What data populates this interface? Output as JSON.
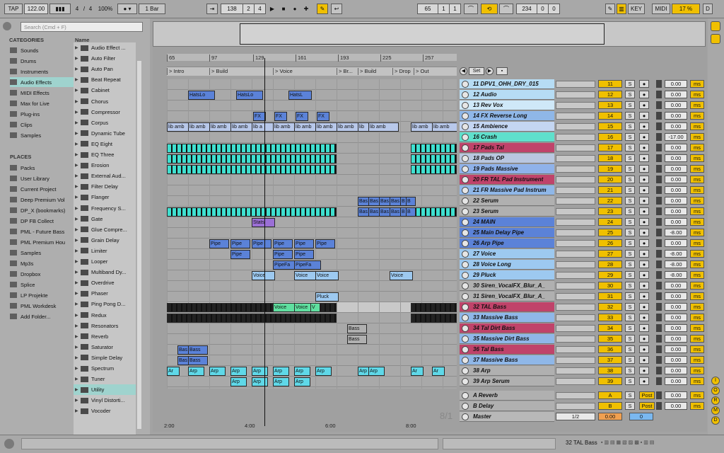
{
  "transport": {
    "tap": "TAP",
    "tempo": "122.00",
    "sig_num": "4",
    "sig_den": "4",
    "zoom": "100%",
    "quant": "1 Bar",
    "pos": [
      "138",
      "2",
      "4"
    ],
    "loop_start": [
      "65",
      "1",
      "1"
    ],
    "loop_len": [
      "234",
      "0",
      "0"
    ],
    "key": "KEY",
    "midi": "MIDI",
    "cpu": "17 %",
    "d": "D"
  },
  "browser": {
    "search_placeholder": "Search (Cmd + F)",
    "categories_header": "CATEGORIES",
    "categories": [
      "Sounds",
      "Drums",
      "Instruments",
      "Audio Effects",
      "MIDI Effects",
      "Max for Live",
      "Plug-ins",
      "Clips",
      "Samples"
    ],
    "places_header": "PLACES",
    "places": [
      "Packs",
      "User Library",
      "Current Project",
      "Deep Premium Vol",
      "DP_X (bookmarks)",
      "DP FB Collect",
      "PML - Future Bass",
      "PML Premium Hou",
      "Samples",
      "Mp3s",
      "Dropbox",
      "Splice",
      "LP Projekte",
      "PML Workdesk",
      "Add Folder..."
    ],
    "name_header": "Name",
    "items": [
      "Audio Effect ...",
      "Auto Filter",
      "Auto Pan",
      "Beat Repeat",
      "Cabinet",
      "Chorus",
      "Compressor",
      "Corpus",
      "Dynamic Tube",
      "EQ Eight",
      "EQ Three",
      "Erosion",
      "External Aud...",
      "Filter Delay",
      "Flanger",
      "Frequency S...",
      "Gate",
      "Glue Compre...",
      "Grain Delay",
      "Limiter",
      "Looper",
      "Multiband Dy...",
      "Overdrive",
      "Phaser",
      "Ping Pong D...",
      "Redux",
      "Resonators",
      "Reverb",
      "Saturator",
      "Simple Delay",
      "Spectrum",
      "Tuner",
      "Utility",
      "Vinyl Distorti...",
      "Vocoder"
    ]
  },
  "ruler": [
    "65",
    "97",
    "129",
    "161",
    "193",
    "225",
    "257"
  ],
  "locators": [
    "Intro",
    "Build",
    "Voice",
    "Br...",
    "Build",
    "Drop",
    "Out"
  ],
  "set_label": "Set",
  "times": [
    "2:00",
    "4:00",
    "6:00",
    "8:00"
  ],
  "bar_counter": "8/1",
  "tracks": [
    {
      "name": "11 DPV1_OHH_DRY_015",
      "num": "11",
      "vol": "0.00",
      "color": "#b6dcf4"
    },
    {
      "name": "12 Audio",
      "num": "12",
      "vol": "0.00",
      "color": "#b6dcf4"
    },
    {
      "name": "13 Rev Vox",
      "num": "13",
      "vol": "0.00",
      "color": "#cfe8f8"
    },
    {
      "name": "14 FX Reverse Long",
      "num": "14",
      "vol": "0.00",
      "color": "#8fb7e8"
    },
    {
      "name": "15 Ambience",
      "num": "15",
      "vol": "0.00",
      "color": "#c4d6f2"
    },
    {
      "name": "16 Crash",
      "num": "16",
      "vol": "-17.00",
      "color": "#5fe0cc"
    },
    {
      "name": "17 Pads Tal",
      "num": "17",
      "vol": "0.00",
      "color": "#c0436a"
    },
    {
      "name": "18 Pads OP",
      "num": "18",
      "vol": "0.00",
      "color": "#b9c7e0"
    },
    {
      "name": "19 Pads Massive",
      "num": "19",
      "vol": "0.00",
      "color": "#8fb2ea"
    },
    {
      "name": "20 FR TAL Pad Instrument",
      "num": "20",
      "vol": "0.00",
      "color": "#c0436a"
    },
    {
      "name": "21 FR Massive Pad Instrum",
      "num": "21",
      "vol": "0.00",
      "color": "#8fb7e8"
    },
    {
      "name": "22 Serum",
      "num": "22",
      "vol": "0.00",
      "color": "#b0b0b0"
    },
    {
      "name": "23 Serum",
      "num": "23",
      "vol": "0.00",
      "color": "#b0b0b0"
    },
    {
      "name": "24 MAIN",
      "num": "24",
      "vol": "0.00",
      "color": "#5b82d8"
    },
    {
      "name": "25 Main Delay Pipe",
      "num": "25",
      "vol": "-8.00",
      "color": "#5b82d8"
    },
    {
      "name": "26 Arp Pipe",
      "num": "26",
      "vol": "0.00",
      "color": "#5b82d8"
    },
    {
      "name": "27 Voice",
      "num": "27",
      "vol": "-8.00",
      "color": "#9dc9f0"
    },
    {
      "name": "28 Voice Long",
      "num": "28",
      "vol": "-8.00",
      "color": "#9dc9f0"
    },
    {
      "name": "29 Pluck",
      "num": "29",
      "vol": "-8.00",
      "color": "#9dc9f0"
    },
    {
      "name": "30 Siren_VocalFX_Blur_A_",
      "num": "30",
      "vol": "0.00",
      "color": "#b0b0b0"
    },
    {
      "name": "31 Siren_VocalFX_Blur_A_",
      "num": "31",
      "vol": "0.00",
      "color": "#b0b0b0"
    },
    {
      "name": "32 TAL Bass",
      "num": "32",
      "vol": "0.00",
      "color": "#c0436a"
    },
    {
      "name": "33 Massive Bass",
      "num": "33",
      "vol": "0.00",
      "color": "#8fb7e8"
    },
    {
      "name": "34 Tal Dirt Bass",
      "num": "34",
      "vol": "0.00",
      "color": "#c0436a"
    },
    {
      "name": "35 Massive Dirt Bass",
      "num": "35",
      "vol": "0.00",
      "color": "#8fb7e8"
    },
    {
      "name": "36 Tal Bass",
      "num": "36",
      "vol": "0.00",
      "color": "#c0436a"
    },
    {
      "name": "37 Massive Bass",
      "num": "37",
      "vol": "0.00",
      "color": "#8fb7e8"
    },
    {
      "name": "38 Arp",
      "num": "38",
      "vol": "0.00",
      "color": "#b0b0b0"
    },
    {
      "name": "39 Arp Serum",
      "num": "39",
      "vol": "0.00",
      "color": "#b0b0b0"
    }
  ],
  "returns": [
    {
      "name": "A Reverb",
      "num": "A",
      "vol": "0.00",
      "send": "Post"
    },
    {
      "name": "B Delay",
      "num": "B",
      "vol": "0.00",
      "send": "Post"
    }
  ],
  "master": {
    "name": "Master",
    "sel": "1/2",
    "vol": "0.00",
    "num": "0"
  },
  "unit_ms": "ms",
  "btn_s": "S",
  "status": {
    "track": "32 TAL Bass"
  },
  "right_letters": [
    "I",
    "O",
    "R",
    "M",
    "D"
  ],
  "clips": [
    [
      1,
      30,
      "HatsLo",
      "#5b82d8"
    ],
    [
      1,
      98,
      "HatsLo",
      "#5b82d8"
    ],
    [
      1,
      172,
      "HatsL",
      "#5b82d8"
    ],
    [
      3,
      122,
      "FX",
      "#5b82d8"
    ],
    [
      3,
      152,
      "FX",
      "#5b82d8"
    ],
    [
      3,
      182,
      "FX",
      "#5b82d8"
    ],
    [
      3,
      212,
      "FX",
      "#5b82d8"
    ],
    [
      4,
      0,
      "lib amb",
      "#b8c8ea"
    ],
    [
      4,
      30,
      "lib amb",
      "#b8c8ea"
    ],
    [
      4,
      60,
      "lib amb",
      "#b8c8ea"
    ],
    [
      4,
      90,
      "lib amb",
      "#b8c8ea"
    ],
    [
      4,
      120,
      "lib a",
      "#b8c8ea"
    ],
    [
      4,
      150,
      "lib amb",
      "#b8c8ea"
    ],
    [
      4,
      180,
      "lib amb",
      "#b8c8ea"
    ],
    [
      4,
      210,
      "lib amb",
      "#b8c8ea"
    ],
    [
      4,
      240,
      "lib amb",
      "#b8c8ea"
    ],
    [
      4,
      270,
      "lib",
      "#b8c8ea"
    ],
    [
      4,
      285,
      "lib amb",
      "#b8c8ea"
    ],
    [
      4,
      345,
      "lib amb",
      "#b8c8ea"
    ],
    [
      4,
      375,
      "lib amb",
      "#b8c8ea"
    ],
    [
      11,
      270,
      "Bas",
      "#5b82d8"
    ],
    [
      11,
      285,
      "Bas",
      "#5b82d8"
    ],
    [
      11,
      300,
      "Bas",
      "#5b82d8"
    ],
    [
      11,
      315,
      "Bas",
      "#5b82d8"
    ],
    [
      11,
      330,
      "B",
      "#5b82d8"
    ],
    [
      11,
      338,
      "B",
      "#5b82d8"
    ],
    [
      12,
      270,
      "Bas",
      "#5b82d8"
    ],
    [
      12,
      285,
      "Bas",
      "#5b82d8"
    ],
    [
      12,
      300,
      "Bas",
      "#5b82d8"
    ],
    [
      12,
      315,
      "Bas",
      "#5b82d8"
    ],
    [
      12,
      330,
      "B",
      "#5b82d8"
    ],
    [
      12,
      338,
      "B",
      "#5b82d8"
    ],
    [
      13,
      120,
      "Stats",
      "#9b6fd6"
    ],
    [
      15,
      60,
      "Pipe",
      "#5b82d8"
    ],
    [
      15,
      90,
      "Pipe",
      "#5b82d8"
    ],
    [
      15,
      120,
      "Pipe",
      "#5b82d8"
    ],
    [
      15,
      150,
      "Pipe",
      "#5b82d8"
    ],
    [
      15,
      180,
      "Pipe",
      "#5b82d8"
    ],
    [
      15,
      210,
      "Pipe",
      "#5b82d8"
    ],
    [
      16,
      90,
      "Pipe",
      "#5b82d8"
    ],
    [
      16,
      150,
      "Pipe",
      "#5b82d8"
    ],
    [
      16,
      180,
      "Pipe",
      "#5b82d8"
    ],
    [
      17,
      150,
      "PipeFa",
      "#5b82d8"
    ],
    [
      17,
      180,
      "PipeFa",
      "#5b82d8"
    ],
    [
      18,
      120,
      "Voice",
      "#9dc9f0"
    ],
    [
      18,
      180,
      "Voice",
      "#9dc9f0"
    ],
    [
      18,
      210,
      "Voice",
      "#9dc9f0"
    ],
    [
      18,
      315,
      "Voice",
      "#9dc9f0"
    ],
    [
      20,
      210,
      "Pluck",
      "#9dc9f0"
    ],
    [
      21,
      150,
      "Voice",
      "#5fe0a0"
    ],
    [
      21,
      180,
      "Voice",
      "#5fe0a0"
    ],
    [
      21,
      203,
      "V",
      "#5fe0a0"
    ],
    [
      23,
      255,
      "Bass",
      "#b0b0b0"
    ],
    [
      24,
      255,
      "Bass",
      "#b0b0b0"
    ],
    [
      25,
      15,
      "Bas",
      "#5b82d8"
    ],
    [
      25,
      30,
      "Bass",
      "#5b82d8"
    ],
    [
      26,
      15,
      "Bas",
      "#5b82d8"
    ],
    [
      26,
      30,
      "Bass",
      "#5b82d8"
    ],
    [
      27,
      0,
      "Ar",
      "#5fd8e8"
    ],
    [
      27,
      30,
      "Arp",
      "#5fd8e8"
    ],
    [
      27,
      60,
      "Arp",
      "#5fd8e8"
    ],
    [
      27,
      90,
      "Arp",
      "#5fd8e8"
    ],
    [
      27,
      120,
      "Arp",
      "#5fd8e8"
    ],
    [
      27,
      150,
      "Arp",
      "#5fd8e8"
    ],
    [
      27,
      180,
      "Arp",
      "#5fd8e8"
    ],
    [
      27,
      210,
      "Arp",
      "#5fd8e8"
    ],
    [
      27,
      270,
      "Arp",
      "#5fd8e8"
    ],
    [
      27,
      285,
      "Arp",
      "#5fd8e8"
    ],
    [
      27,
      345,
      "Ar",
      "#5fd8e8"
    ],
    [
      27,
      375,
      "Ar",
      "#5fd8e8"
    ],
    [
      28,
      90,
      "Arp",
      "#5fd8e8"
    ],
    [
      28,
      120,
      "Arp",
      "#5fd8e8"
    ],
    [
      28,
      150,
      "Arp",
      "#5fd8e8"
    ],
    [
      28,
      180,
      "Arp",
      "#5fd8e8"
    ]
  ]
}
